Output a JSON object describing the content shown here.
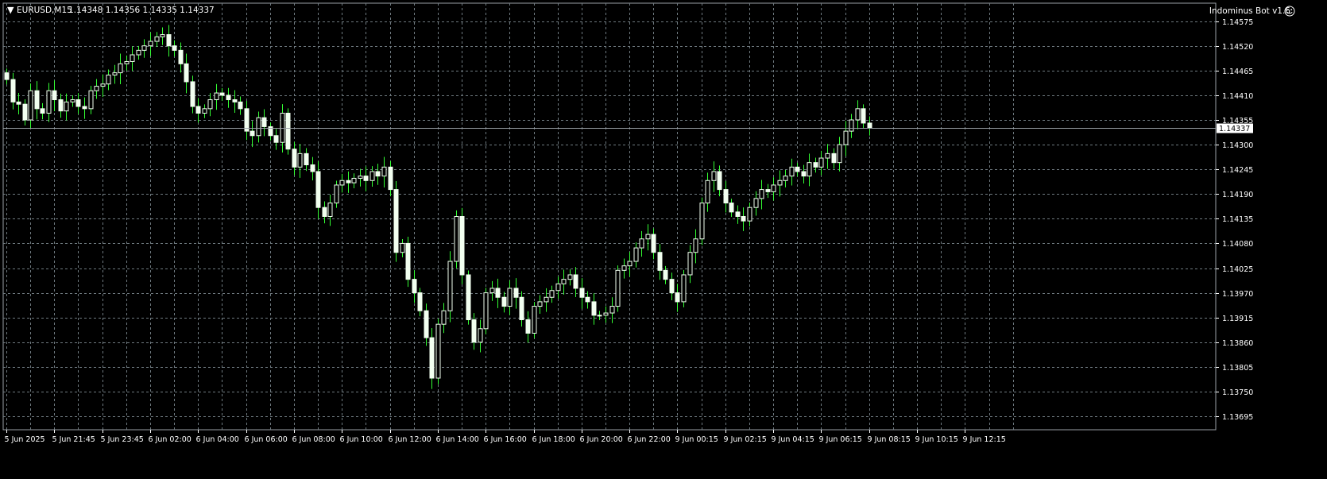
{
  "symbol_header": {
    "symbol": "EURUSD,M15",
    "ohlc": "1.14348 1.14356 1.14335 1.14337"
  },
  "expert_label": "Indominus Bot v1.6",
  "colors": {
    "background": "#000000",
    "grid": "#6f7a80",
    "bull": "#f2fff0",
    "bear": "#f2fff0",
    "wick": "#33ff33",
    "axis_text": "#ffffff",
    "bid_line": "#9aa0a6"
  },
  "chart_data": {
    "type": "candlestick",
    "symbol": "EURUSD",
    "timeframe": "M15",
    "current_price": 1.14337,
    "ylim": [
      1.13665,
      1.14615
    ],
    "y_ticks": [
      "1.14575",
      "1.14520",
      "1.14465",
      "1.14410",
      "1.14355",
      "1.14300",
      "1.14245",
      "1.14190",
      "1.14135",
      "1.14080",
      "1.14025",
      "1.13970",
      "1.13915",
      "1.13860",
      "1.13805",
      "1.13750",
      "1.13695"
    ],
    "y_tick_values": [
      1.14575,
      1.1452,
      1.14465,
      1.1441,
      1.14355,
      1.143,
      1.14245,
      1.1419,
      1.14135,
      1.1408,
      1.14025,
      1.1397,
      1.13915,
      1.1386,
      1.13805,
      1.1375,
      1.13695
    ],
    "x_ticks": [
      "5 Jun 2025",
      "5 Jun 21:45",
      "5 Jun 23:45",
      "6 Jun 02:00",
      "6 Jun 04:00",
      "6 Jun 06:00",
      "6 Jun 08:00",
      "6 Jun 10:00",
      "6 Jun 12:00",
      "6 Jun 14:00",
      "6 Jun 16:00",
      "6 Jun 18:00",
      "6 Jun 20:00",
      "6 Jun 22:00",
      "9 Jun 00:15",
      "9 Jun 02:15",
      "9 Jun 04:15",
      "9 Jun 06:15",
      "9 Jun 08:15",
      "9 Jun 10:15",
      "9 Jun 12:15"
    ],
    "x_tick_bar_index": [
      0,
      8,
      16,
      24,
      32,
      40,
      48,
      56,
      64,
      72,
      80,
      88,
      96,
      104,
      112,
      120,
      128,
      136,
      144,
      152,
      160
    ],
    "grid": true,
    "close_path": [
      1.14445,
      1.14395,
      1.1439,
      1.14355,
      1.1442,
      1.1438,
      1.1437,
      1.1442,
      1.144,
      1.14375,
      1.14395,
      1.144,
      1.14385,
      1.1438,
      1.1442,
      1.1443,
      1.14435,
      1.14455,
      1.1446,
      1.1448,
      1.14485,
      1.145,
      1.1451,
      1.1452,
      1.1453,
      1.1454,
      1.14545,
      1.1452,
      1.1451,
      1.1448,
      1.1444,
      1.14385,
      1.1437,
      1.1438,
      1.144,
      1.14415,
      1.1441,
      1.144,
      1.14395,
      1.1438,
      1.1433,
      1.1432,
      1.1436,
      1.1434,
      1.1432,
      1.14305,
      1.1437,
      1.1429,
      1.1425,
      1.1428,
      1.14255,
      1.1424,
      1.1416,
      1.1414,
      1.1417,
      1.1421,
      1.1422,
      1.14215,
      1.14225,
      1.1423,
      1.1422,
      1.1424,
      1.1423,
      1.1425,
      1.142,
      1.1406,
      1.1408,
      1.14,
      1.1397,
      1.1393,
      1.1387,
      1.1378,
      1.139,
      1.1393,
      1.1404,
      1.1414,
      1.1401,
      1.1391,
      1.1386,
      1.1389,
      1.1397,
      1.1398,
      1.1396,
      1.1394,
      1.1398,
      1.1396,
      1.1391,
      1.1388,
      1.1394,
      1.1395,
      1.1396,
      1.13975,
      1.1399,
      1.14,
      1.1401,
      1.1398,
      1.1396,
      1.1395,
      1.1392,
      1.1392,
      1.13925,
      1.1394,
      1.1402,
      1.1403,
      1.1404,
      1.1407,
      1.1409,
      1.141,
      1.1406,
      1.1402,
      1.14,
      1.1397,
      1.1395,
      1.1401,
      1.1406,
      1.1409,
      1.1417,
      1.1422,
      1.1424,
      1.142,
      1.1417,
      1.1415,
      1.1414,
      1.1413,
      1.1416,
      1.1418,
      1.142,
      1.14195,
      1.1421,
      1.1422,
      1.1423,
      1.1425,
      1.1424,
      1.1423,
      1.1426,
      1.1425,
      1.1427,
      1.1428,
      1.1426,
      1.143,
      1.1433,
      1.14355,
      1.1438,
      1.14348,
      1.14337
    ],
    "title": "",
    "xlabel": "",
    "ylabel": ""
  }
}
